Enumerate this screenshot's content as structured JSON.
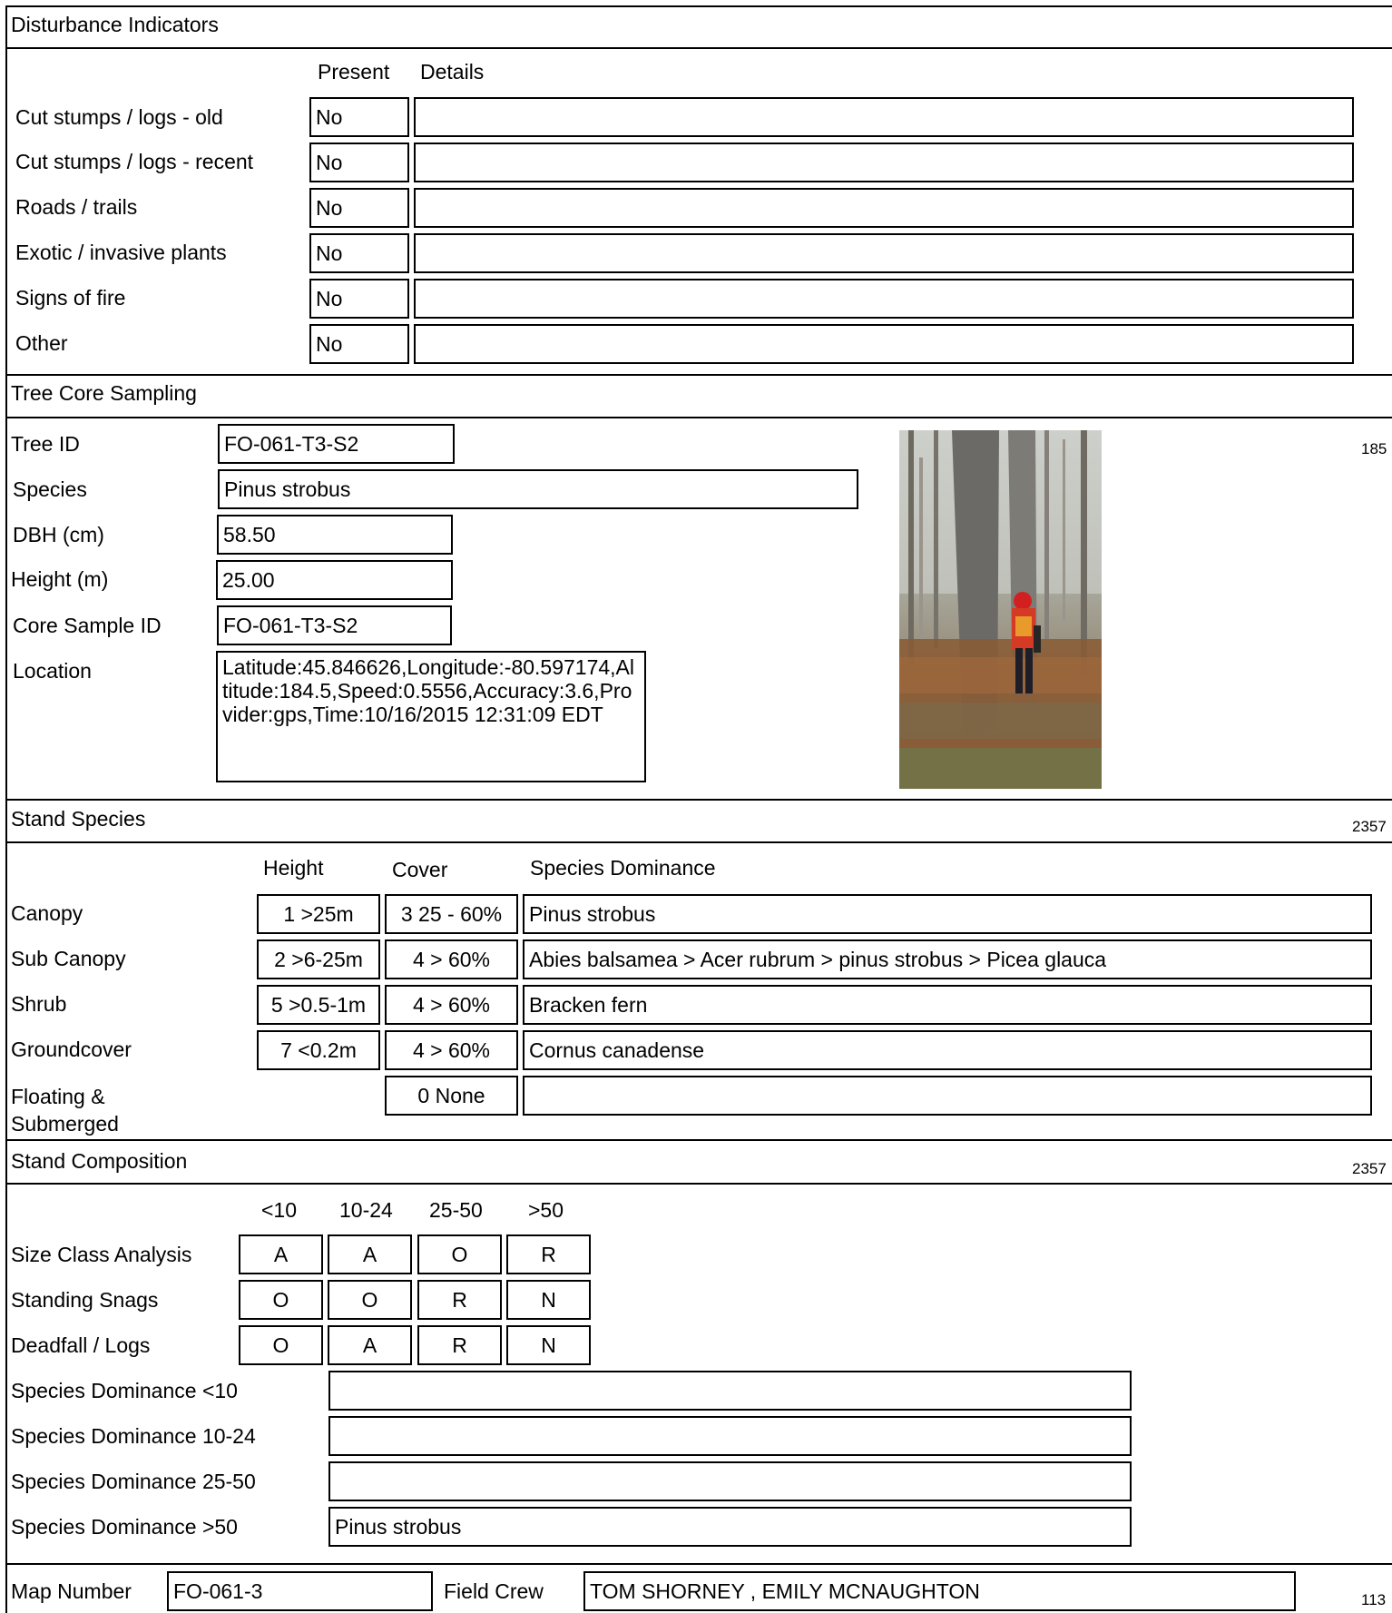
{
  "disturbance": {
    "title": "Disturbance Indicators",
    "col_present": "Present",
    "col_details": "Details",
    "rows": [
      {
        "label": "Cut stumps / logs - old",
        "present": "No",
        "details": ""
      },
      {
        "label": "Cut stumps / logs - recent",
        "present": "No",
        "details": ""
      },
      {
        "label": "Roads / trails",
        "present": "No",
        "details": ""
      },
      {
        "label": "Exotic / invasive plants",
        "present": "No",
        "details": ""
      },
      {
        "label": "Signs of fire",
        "present": "No",
        "details": ""
      },
      {
        "label": "Other",
        "present": "No",
        "details": ""
      }
    ]
  },
  "tree_core": {
    "title": "Tree Core Sampling",
    "side_number": "185",
    "tree_id_label": "Tree ID",
    "tree_id": "FO-061-T3-S2",
    "species_label": "Species",
    "species": "Pinus strobus",
    "dbh_label": "DBH (cm)",
    "dbh": "58.50",
    "height_label": "Height (m)",
    "height": "25.00",
    "core_label": "Core Sample ID",
    "core_id": "FO-061-T3-S2",
    "location_label": "Location",
    "location": "Latitude:45.846626,Longitude:-80.597174,Altitude:184.5,Speed:0.5556,Accuracy:3.6,Provider:gps,Time:10/16/2015 12:31:09 EDT"
  },
  "stand_species": {
    "title": "Stand Species",
    "side_number": "2357",
    "col_height": "Height",
    "col_cover": "Cover",
    "col_dominance": "Species Dominance",
    "rows": [
      {
        "label": "Canopy",
        "height": "1 >25m",
        "cover": "3 25 - 60%",
        "dominance": "Pinus strobus"
      },
      {
        "label": "Sub Canopy",
        "height": "2 >6-25m",
        "cover": "4 > 60%",
        "dominance": "Abies balsamea > Acer rubrum > pinus strobus > Picea glauca"
      },
      {
        "label": "Shrub",
        "height": "5 >0.5-1m",
        "cover": "4 > 60%",
        "dominance": "Bracken fern"
      },
      {
        "label": "Groundcover",
        "height": "7 <0.2m",
        "cover": "4 > 60%",
        "dominance": "Cornus canadense"
      },
      {
        "label": "Floating & Submerged",
        "height": "",
        "cover": "0 None",
        "dominance": ""
      }
    ]
  },
  "stand_composition": {
    "title": "Stand Composition",
    "side_number": "2357",
    "columns": [
      "<10",
      "10-24",
      "25-50",
      ">50"
    ],
    "rows": [
      {
        "label": "Size Class Analysis",
        "values": [
          "A",
          "A",
          "O",
          "R"
        ]
      },
      {
        "label": "Standing Snags",
        "values": [
          "O",
          "O",
          "R",
          "N"
        ]
      },
      {
        "label": "Deadfall / Logs",
        "values": [
          "O",
          "A",
          "R",
          "N"
        ]
      }
    ],
    "dominance": [
      {
        "label": "Species Dominance <10",
        "value": ""
      },
      {
        "label": "Species Dominance 10-24",
        "value": ""
      },
      {
        "label": "Species Dominance 25-50",
        "value": ""
      },
      {
        "label": "Species Dominance >50",
        "value": "Pinus strobus"
      }
    ]
  },
  "footer": {
    "map_label": "Map Number",
    "map_number": "FO-061-3",
    "crew_label": "Field Crew",
    "crew": "TOM SHORNEY ,  EMILY  MCNAUGHTON",
    "side_number": "113"
  }
}
